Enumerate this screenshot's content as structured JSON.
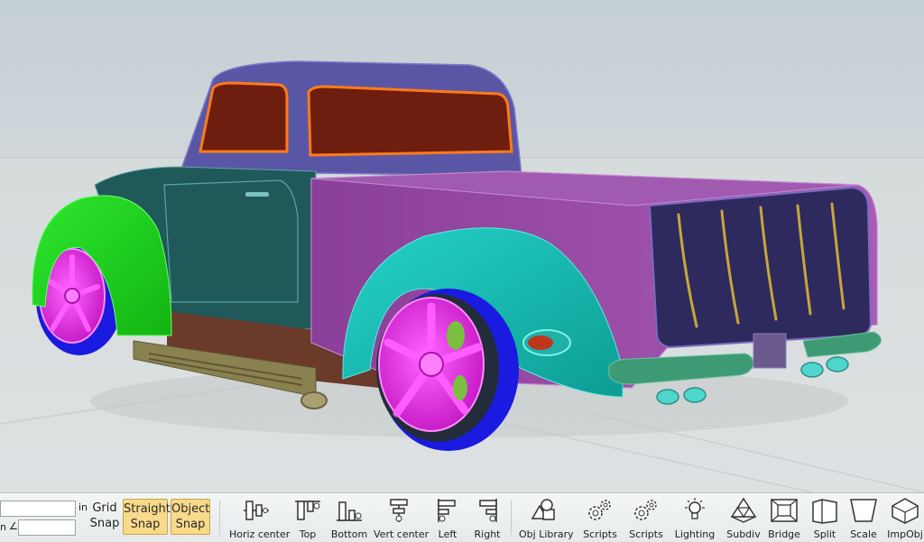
{
  "inputs": {
    "top_value": "",
    "top_unit": "in",
    "bottom_value": "",
    "bottom_unit_prefix": "n",
    "angle_symbol": "∠"
  },
  "snap": {
    "grid_snap_line1": "Grid",
    "grid_snap_line2": "Snap",
    "straight_snap_line1": "Straight",
    "straight_snap_line2": "Snap",
    "object_snap_line1": "Object",
    "object_snap_line2": "Snap",
    "active_color": "#f9d98a"
  },
  "tools": [
    {
      "label": "Horiz center",
      "icon": "horiz-center-icon"
    },
    {
      "label": "Top",
      "icon": "align-top-icon"
    },
    {
      "label": "Bottom",
      "icon": "align-bottom-icon"
    },
    {
      "label": "Vert center",
      "icon": "vert-center-icon"
    },
    {
      "label": "Left",
      "icon": "align-left-icon"
    },
    {
      "label": "Right",
      "icon": "align-right-icon"
    },
    {
      "label": "Obj Library",
      "icon": "object-library-icon"
    },
    {
      "label": "Scripts",
      "icon": "scripts-gears-icon"
    },
    {
      "label": "Scripts",
      "icon": "scripts-gears-icon"
    },
    {
      "label": "Lighting",
      "icon": "lightbulb-icon"
    },
    {
      "label": "Subdiv",
      "icon": "subdivide-icon"
    },
    {
      "label": "Bridge",
      "icon": "bridge-icon"
    },
    {
      "label": "Split",
      "icon": "split-icon"
    },
    {
      "label": "Scale",
      "icon": "scale-icon"
    },
    {
      "label": "ImpObj",
      "icon": "import-object-icon"
    }
  ],
  "scene": {
    "sky_color": "#c9d3d7",
    "floor_color": "#d9dedf",
    "cab_color": "#20595a",
    "roof_color": "#5a56a6",
    "bed_color": "#9a4fa6",
    "front_fender_color": "#1fd11f",
    "rear_fender_color": "#14c2b8",
    "wheel_color": "#e62ee6",
    "tire_color": "#1a1ae0",
    "window_color": "#6e1e0f"
  }
}
